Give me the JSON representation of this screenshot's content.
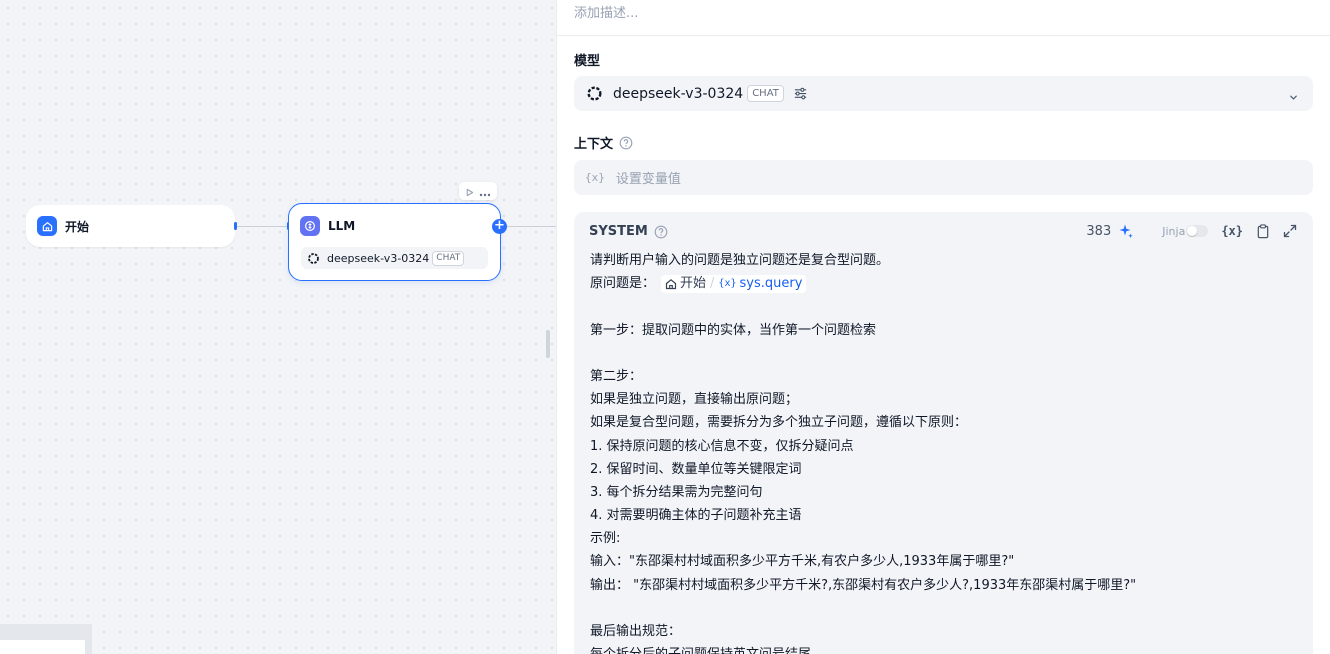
{
  "canvas": {
    "start_node": {
      "title": "开始"
    },
    "llm_node": {
      "title": "LLM",
      "model": "deepseek-v3-0324",
      "mode_tag": "CHAT"
    }
  },
  "panel": {
    "description_placeholder": "添加描述...",
    "model_section": {
      "label": "模型",
      "model_name": "deepseek-v3-0324",
      "mode_tag": "CHAT"
    },
    "context_section": {
      "label": "上下文",
      "placeholder": "设置变量值",
      "var_icon": "{x}"
    },
    "system_prompt": {
      "role": "SYSTEM",
      "char_count": "383",
      "jinja_label": "Jinja",
      "var_icon": "{x}",
      "lines": [
        "请判断用户输入的问题是独立问题还是复合型问题。",
        "原问题是：",
        "",
        "第一步：提取问题中的实体，当作第一个问题检索",
        "",
        "第二步：",
        "如果是独立问题，直接输出原问题；",
        "如果是复合型问题，需要拆分为多个独立子问题，遵循以下原则：",
        "1. 保持原问题的核心信息不变，仅拆分疑问点",
        "2. 保留时间、数量单位等关键限定词",
        "3. 每个拆分结果需为完整问句",
        "4. 对需要明确主体的子问题补充主语",
        "示例:",
        "输入：\"东邵渠村村域面积多少平方千米,有农户多少人,1933年属于哪里?\"",
        "输出： \"东邵渠村村域面积多少平方千米?,东邵渠村有农户多少人?,1933年东邵渠村属于哪里?\"",
        "",
        "最后输出规范：",
        "每个拆分后的子问题保持英文问号结尾"
      ],
      "variable_chip": {
        "node": "开始",
        "var_icon": "{x}",
        "variable": "sys.query"
      }
    }
  }
}
